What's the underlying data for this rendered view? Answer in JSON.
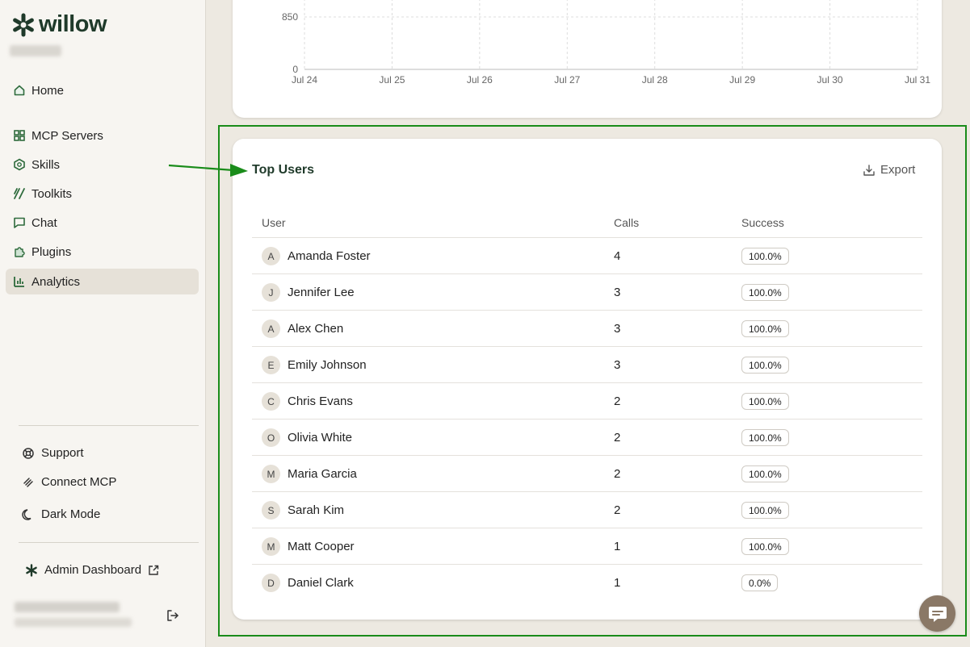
{
  "app": {
    "logo_text": "willow"
  },
  "sidebar": {
    "items": [
      {
        "label": "Home",
        "icon": "home-icon"
      },
      {
        "label": "MCP Servers",
        "icon": "servers-icon"
      },
      {
        "label": "Skills",
        "icon": "hexagon-icon"
      },
      {
        "label": "Toolkits",
        "icon": "toolkit-icon"
      },
      {
        "label": "Chat",
        "icon": "chat-icon"
      },
      {
        "label": "Plugins",
        "icon": "puzzle-icon"
      },
      {
        "label": "Analytics",
        "icon": "chart-icon",
        "active": true
      }
    ],
    "footer": [
      {
        "label": "Support",
        "icon": "lifebuoy-icon"
      },
      {
        "label": "Connect MCP",
        "icon": "link-icon"
      },
      {
        "label": "Dark Mode",
        "icon": "moon-icon"
      }
    ],
    "admin": {
      "label": "Admin Dashboard",
      "icon": "external-link-icon"
    }
  },
  "chart": {
    "y_ticks": [
      "0",
      "850"
    ],
    "x_ticks": [
      "Jul 24",
      "Jul 25",
      "Jul 26",
      "Jul 27",
      "Jul 28",
      "Jul 29",
      "Jul 30",
      "Jul 31"
    ]
  },
  "top_users": {
    "title": "Top Users",
    "export_label": "Export",
    "columns": [
      "User",
      "Calls",
      "Success"
    ],
    "rows": [
      {
        "initial": "A",
        "name": "Amanda Foster",
        "calls": "4",
        "success": "100.0%"
      },
      {
        "initial": "J",
        "name": "Jennifer Lee",
        "calls": "3",
        "success": "100.0%"
      },
      {
        "initial": "A",
        "name": "Alex Chen",
        "calls": "3",
        "success": "100.0%"
      },
      {
        "initial": "E",
        "name": "Emily Johnson",
        "calls": "3",
        "success": "100.0%"
      },
      {
        "initial": "C",
        "name": "Chris Evans",
        "calls": "2",
        "success": "100.0%"
      },
      {
        "initial": "O",
        "name": "Olivia White",
        "calls": "2",
        "success": "100.0%"
      },
      {
        "initial": "M",
        "name": "Maria Garcia",
        "calls": "2",
        "success": "100.0%"
      },
      {
        "initial": "S",
        "name": "Sarah Kim",
        "calls": "2",
        "success": "100.0%"
      },
      {
        "initial": "M",
        "name": "Matt Cooper",
        "calls": "1",
        "success": "100.0%"
      },
      {
        "initial": "D",
        "name": "Daniel Clark",
        "calls": "1",
        "success": "0.0%"
      }
    ]
  },
  "colors": {
    "brand": "#1f3a2a",
    "icon_green": "#2e6b3c",
    "annotation": "#1a8c1a",
    "active_nav_bg": "#e6e1d8",
    "chat_fab": "#8a7866"
  }
}
